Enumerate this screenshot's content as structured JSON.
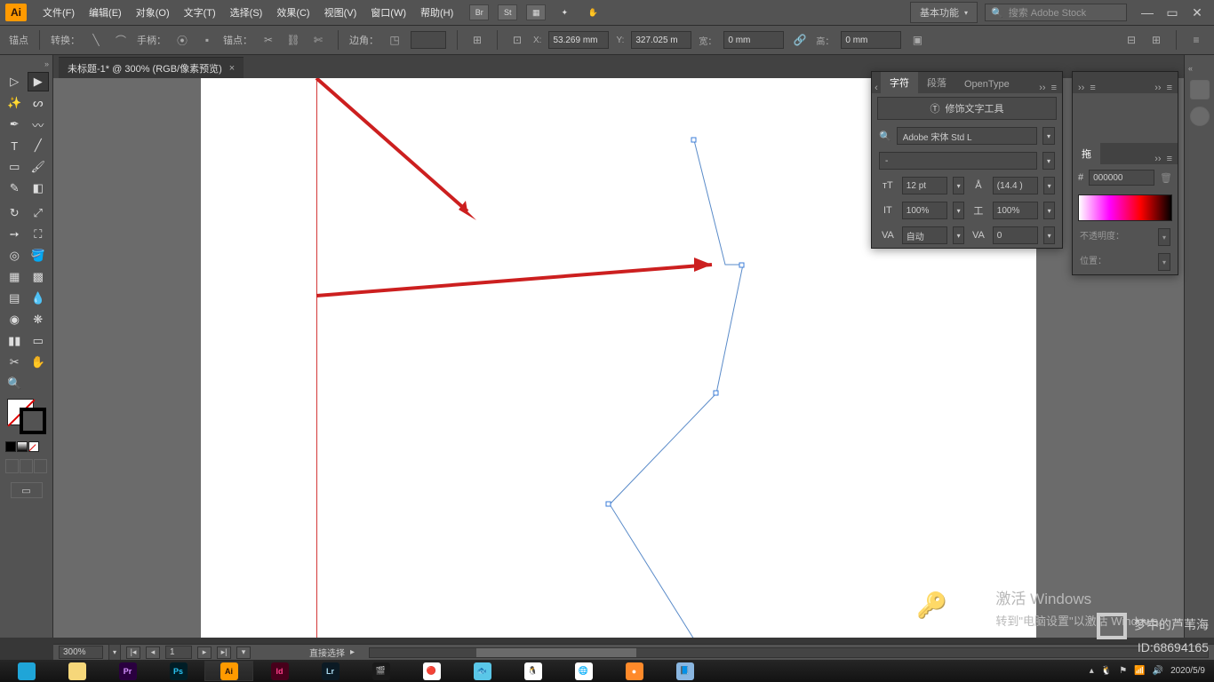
{
  "menu": {
    "items": [
      "文件(F)",
      "编辑(E)",
      "对象(O)",
      "文字(T)",
      "选择(S)",
      "效果(C)",
      "视图(V)",
      "窗口(W)",
      "帮助(H)"
    ],
    "micro": [
      "Br",
      "St"
    ],
    "workspace": "基本功能",
    "search_placeholder": "搜索 Adobe Stock"
  },
  "control": {
    "anchor_label": "锚点",
    "convert_label": "转换：",
    "handle_label": "手柄：",
    "anchors_label": "锚点：",
    "corner_label": "边角：",
    "x_label": "X:",
    "x_val": "53.269 mm",
    "y_label": "Y:",
    "y_val": "327.025 m",
    "w_label": "宽：",
    "w_val": "0 mm",
    "h_label": "高：",
    "h_val": "0 mm"
  },
  "doc": {
    "tab": "未标题-1* @ 300% (RGB/像素预览)"
  },
  "char_panel": {
    "tabs": [
      "字符",
      "段落",
      "OpenType"
    ],
    "touch_label": "修饰文字工具",
    "font": "Adobe 宋体 Std L",
    "style": "-",
    "size": "12 pt",
    "leading": "(14.4 )",
    "vscale": "100%",
    "hscale": "100%",
    "kerning": "自动",
    "tracking": "0"
  },
  "color_panel": {
    "tab": "拖",
    "hex_label": "#",
    "hex": "000000",
    "opacity_label": "不透明度：",
    "pos_label": "位置："
  },
  "status": {
    "zoom": "300%",
    "page": "1",
    "tool": "直接选择"
  },
  "activate": {
    "title": "激活 Windows",
    "sub": "转到\"电脑设置\"以激活 Windows。"
  },
  "signature": {
    "l1": "梦中的芦苇海",
    "l2": "ID:68694165"
  },
  "date": "2020/5/9",
  "taskbar_apps": [
    {
      "bg": "#1fa5d8",
      "txt": ""
    },
    {
      "bg": "#f6d77a",
      "txt": ""
    },
    {
      "bg": "#2a003f",
      "txt": "Pr",
      "fg": "#d490ff"
    },
    {
      "bg": "#001d26",
      "txt": "Ps",
      "fg": "#29c5f6"
    },
    {
      "bg": "#ff9a00",
      "txt": "Ai",
      "fg": "#2a140a"
    },
    {
      "bg": "#47001b",
      "txt": "Id",
      "fg": "#ff3e8a"
    },
    {
      "bg": "#0b1a24",
      "txt": "Lr",
      "fg": "#a9d9ef"
    },
    {
      "bg": "#1a1a1a",
      "txt": "🎬"
    },
    {
      "bg": "#fff",
      "txt": "🔴"
    },
    {
      "bg": "#5ac7e8",
      "txt": "🐟"
    },
    {
      "bg": "#fff",
      "txt": "🐧"
    },
    {
      "bg": "#fff",
      "txt": "🌐"
    },
    {
      "bg": "#ff8a2a",
      "txt": "●"
    },
    {
      "bg": "#8ab6e0",
      "txt": "📘"
    }
  ]
}
